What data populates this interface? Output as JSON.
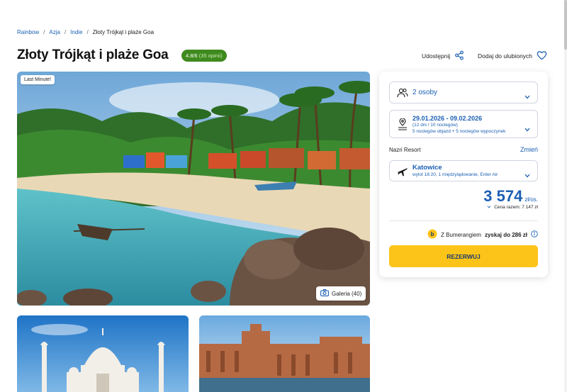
{
  "breadcrumb": {
    "items": [
      "Rainbow",
      "Azja",
      "Indie"
    ],
    "separator": "/",
    "current": "Złoty Trójkąt i plaże Goa"
  },
  "offer": {
    "title": "Złoty Trójkąt i plaże Goa",
    "rating": "4.8/6",
    "rating_count": "(35 opinii)"
  },
  "actions": {
    "share_label": "Udostępnij",
    "favorite_label": "Dodaj do ulubionych"
  },
  "gallery": {
    "badge": "Last Minute!",
    "gallery_label": "Galeria (40)"
  },
  "booking": {
    "people": "2 osoby",
    "dates": "29.01.2026 - 09.02.2026",
    "dates_nights": "(12 dni / 10 noclegów)",
    "dates_detail": "5 noclegów objazd + 5 noclegów wypoczynek",
    "resort": "Nazri Resort",
    "change_label": "Zmień",
    "departure_city": "Katowice",
    "flight_detail": "wylot 18:20, 1 międzylądowanie, Enter Air",
    "price": "3 574",
    "price_unit": "zł/os.",
    "total_price": "Cena razem: 7 147 zł",
    "bumerang_text": "Z Bumerangiem",
    "bumerang_value": "zyskaj do 286 zł",
    "reserve_label": "REZERWUJ"
  },
  "colors": {
    "accent_blue": "#1b5fb3",
    "cta_yellow": "#fcc419",
    "rating_green": "#3f8a1e"
  }
}
